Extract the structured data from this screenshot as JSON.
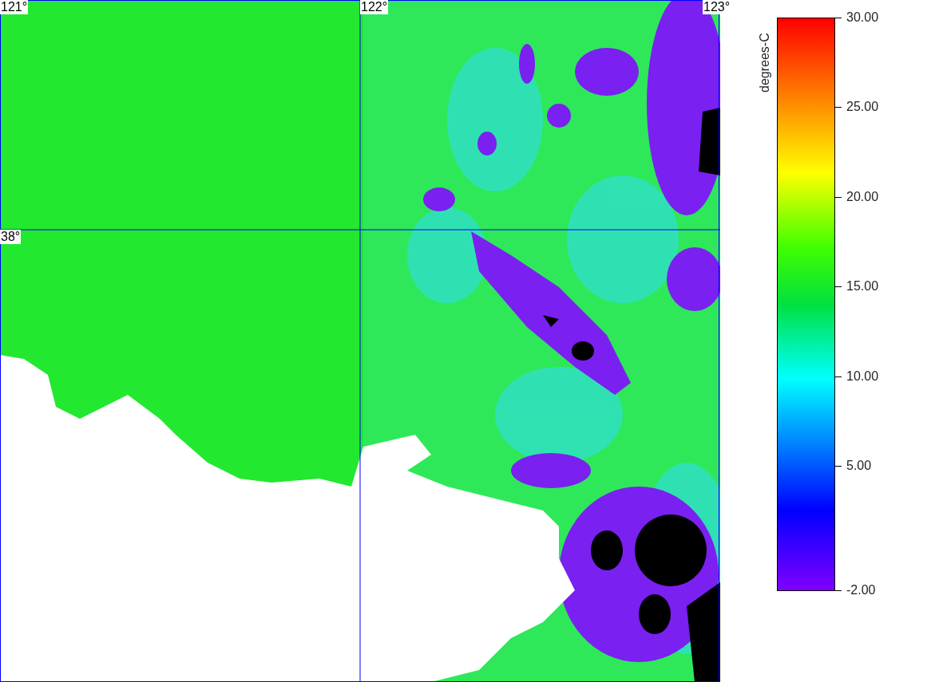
{
  "map": {
    "grid_labels": [
      {
        "text": "121°",
        "kind": "lon"
      },
      {
        "text": "122°",
        "kind": "lon"
      },
      {
        "text": "123°",
        "kind": "lon"
      },
      {
        "text": "38°",
        "kind": "lat"
      }
    ]
  },
  "colorbar": {
    "title": "degrees-C",
    "ticks": [
      "30.00",
      "25.00",
      "20.00",
      "15.00",
      "10.00",
      "5.00",
      "-2.00"
    ]
  }
}
